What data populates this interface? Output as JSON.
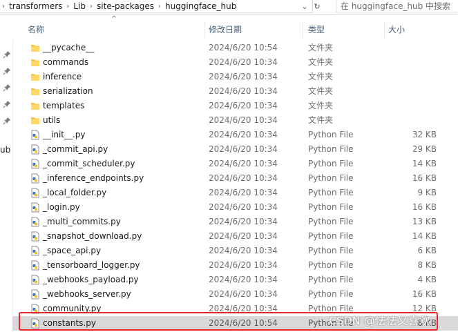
{
  "breadcrumb": [
    "transformers",
    "Lib",
    "site-packages",
    "huggingface_hub"
  ],
  "address_buttons": {
    "dropdown": "⌄",
    "refresh": "↻"
  },
  "search": {
    "placeholder": "在 huggingface_hub 中搜索"
  },
  "nav": {
    "partial_label": "ub"
  },
  "columns": {
    "name": "名称",
    "modified": "修改日期",
    "type": "类型",
    "size": "大小"
  },
  "sort_indicator": "^",
  "files": [
    {
      "name": "__pycache__",
      "modified": "2024/6/20 10:54",
      "type": "文件夹",
      "size": "",
      "kind": "folder"
    },
    {
      "name": "commands",
      "modified": "2024/6/20 10:34",
      "type": "文件夹",
      "size": "",
      "kind": "folder"
    },
    {
      "name": "inference",
      "modified": "2024/6/20 10:34",
      "type": "文件夹",
      "size": "",
      "kind": "folder"
    },
    {
      "name": "serialization",
      "modified": "2024/6/20 10:34",
      "type": "文件夹",
      "size": "",
      "kind": "folder"
    },
    {
      "name": "templates",
      "modified": "2024/6/20 10:34",
      "type": "文件夹",
      "size": "",
      "kind": "folder"
    },
    {
      "name": "utils",
      "modified": "2024/6/20 10:34",
      "type": "文件夹",
      "size": "",
      "kind": "folder"
    },
    {
      "name": "__init__.py",
      "modified": "2024/6/20 10:34",
      "type": "Python File",
      "size": "32 KB",
      "kind": "python"
    },
    {
      "name": "_commit_api.py",
      "modified": "2024/6/20 10:34",
      "type": "Python File",
      "size": "29 KB",
      "kind": "python"
    },
    {
      "name": "_commit_scheduler.py",
      "modified": "2024/6/20 10:34",
      "type": "Python File",
      "size": "14 KB",
      "kind": "python"
    },
    {
      "name": "_inference_endpoints.py",
      "modified": "2024/6/20 10:34",
      "type": "Python File",
      "size": "16 KB",
      "kind": "python"
    },
    {
      "name": "_local_folder.py",
      "modified": "2024/6/20 10:34",
      "type": "Python File",
      "size": "9 KB",
      "kind": "python"
    },
    {
      "name": "_login.py",
      "modified": "2024/6/20 10:34",
      "type": "Python File",
      "size": "16 KB",
      "kind": "python"
    },
    {
      "name": "_multi_commits.py",
      "modified": "2024/6/20 10:34",
      "type": "Python File",
      "size": "13 KB",
      "kind": "python"
    },
    {
      "name": "_snapshot_download.py",
      "modified": "2024/6/20 10:34",
      "type": "Python File",
      "size": "14 KB",
      "kind": "python"
    },
    {
      "name": "_space_api.py",
      "modified": "2024/6/20 10:34",
      "type": "Python File",
      "size": "6 KB",
      "kind": "python"
    },
    {
      "name": "_tensorboard_logger.py",
      "modified": "2024/6/20 10:34",
      "type": "Python File",
      "size": "8 KB",
      "kind": "python"
    },
    {
      "name": "_webhooks_payload.py",
      "modified": "2024/6/20 10:34",
      "type": "Python File",
      "size": "4 KB",
      "kind": "python"
    },
    {
      "name": "_webhooks_server.py",
      "modified": "2024/6/20 10:34",
      "type": "Python File",
      "size": "16 KB",
      "kind": "python"
    },
    {
      "name": "community.py",
      "modified": "2024/6/20 10:34",
      "type": "Python File",
      "size": "12 KB",
      "kind": "python"
    },
    {
      "name": "constants.py",
      "modified": "2024/6/20 10:54",
      "type": "Python File",
      "size": "8 KB",
      "kind": "python",
      "selected": true
    }
  ],
  "watermark": "CSDN @怯怯又喜欢",
  "colors": {
    "highlight_border": "#e8262a",
    "selected_row": "#d9d9d9",
    "folder": "#f5c242",
    "header_text": "#4c607a"
  }
}
